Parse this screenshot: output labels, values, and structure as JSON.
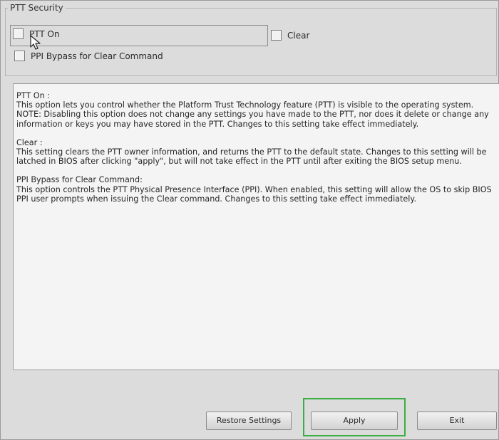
{
  "group": {
    "title": "PTT Security"
  },
  "options": {
    "ptt_on": {
      "label": "PTT On",
      "checked": false
    },
    "clear": {
      "label": "Clear",
      "checked": false
    },
    "ppi_bypass": {
      "label": "PPI Bypass for Clear Command",
      "checked": false
    }
  },
  "description": {
    "ptt_on": "PTT On :\nThis option lets you control whether the Platform Trust Technology feature (PTT) is visible to the operating system.\nNOTE: Disabling this option does not change any settings you have made to the PTT, nor does it delete or change any information or keys you may have stored in the PTT. Changes to this setting take effect immediately.",
    "clear": "Clear :\nThis setting clears the PTT owner information, and returns the PTT to the default state. Changes to this setting will be latched in BIOS after clicking \"apply\", but will not take effect in the PTT until after exiting the BIOS setup menu.",
    "ppi_bypass": "PPI Bypass for Clear Command:\nThis option controls the PTT Physical Presence Interface (PPI). When enabled, this setting will allow the OS to skip BIOS PPI user prompts when issuing the Clear command. Changes to this setting take effect immediately."
  },
  "buttons": {
    "restore": "Restore Settings",
    "apply": "Apply",
    "exit": "Exit"
  },
  "highlight_color": "#3cae43"
}
